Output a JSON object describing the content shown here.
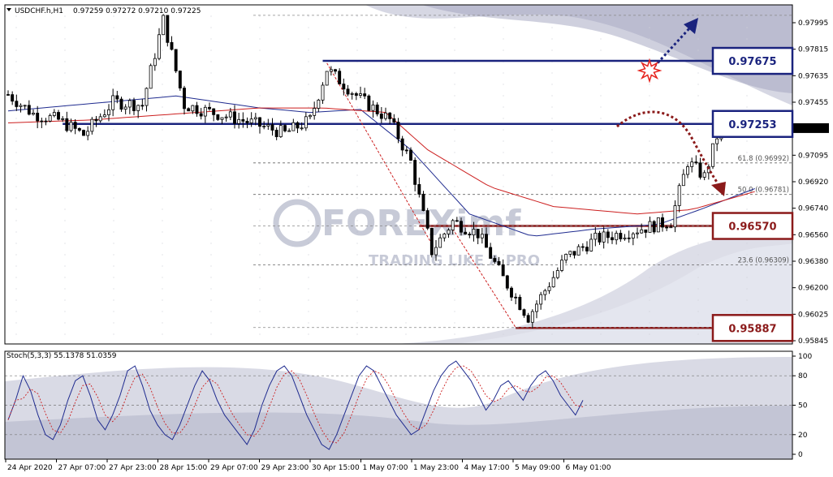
{
  "header": {
    "symbol": "USDCHF.h,H1",
    "ohlc": "0.97259 0.97272 0.97210 0.97225",
    "toggle_icon": "triangle-down-icon"
  },
  "watermark": {
    "brand": "FOREXimf",
    "tagline": "TRADING LIKE A PRO",
    "logo_icon": "foreximf-logo-icon"
  },
  "colors": {
    "blue_level": "#1a237e",
    "red_level": "#8b1a1a",
    "band": "#b4b6cc",
    "ma_fast": "#1f2b8f",
    "ma_slow": "#cc1f1f",
    "candle": "#000000"
  },
  "chart_data": [
    {
      "type": "candlestick",
      "title": "USDCHF.h,H1",
      "ylim": [
        0.9578,
        0.9805
      ],
      "y_ticks": [
        "0.97995",
        "0.97815",
        "0.97635",
        "0.97455",
        "0.97275",
        "0.97095",
        "0.96920",
        "0.96740",
        "0.96560",
        "0.96380",
        "0.96200",
        "0.96025",
        "0.95845"
      ],
      "current_price": "0.97225",
      "x_ticks": [
        "24 Apr 2020",
        "27 Apr 07:00",
        "27 Apr 23:00",
        "28 Apr 15:00",
        "29 Apr 07:00",
        "29 Apr 23:00",
        "30 Apr 15:00",
        "1 May 07:00",
        "1 May 23:00",
        "4 May 17:00",
        "5 May 09:00",
        "6 May 01:00"
      ],
      "price_anchors": [
        [
          0,
          0.9745
        ],
        [
          6,
          0.9732
        ],
        [
          12,
          0.9728
        ],
        [
          18,
          0.9718
        ],
        [
          25,
          0.974
        ],
        [
          32,
          0.9738
        ],
        [
          37,
          0.9795
        ],
        [
          42,
          0.9738
        ],
        [
          50,
          0.9732
        ],
        [
          58,
          0.9726
        ],
        [
          66,
          0.9719
        ],
        [
          72,
          0.9728
        ],
        [
          76,
          0.9762
        ],
        [
          84,
          0.9742
        ],
        [
          91,
          0.9728
        ],
        [
          96,
          0.97
        ],
        [
          101,
          0.964
        ],
        [
          106,
          0.966
        ],
        [
          112,
          0.9652
        ],
        [
          118,
          0.9622
        ],
        [
          124,
          0.9596
        ],
        [
          128,
          0.9614
        ],
        [
          133,
          0.9636
        ],
        [
          140,
          0.9648
        ],
        [
          146,
          0.9652
        ],
        [
          152,
          0.9656
        ],
        [
          158,
          0.966
        ],
        [
          162,
          0.97
        ],
        [
          166,
          0.969
        ],
        [
          170,
          0.9726
        ],
        [
          176,
          0.9722
        ],
        [
          180,
          0.9723
        ]
      ],
      "moving_averages": [
        {
          "name": "ma_fast",
          "points": [
            [
              0,
              0.9734
            ],
            [
              20,
              0.9739
            ],
            [
              40,
              0.9744
            ],
            [
              60,
              0.9736
            ],
            [
              72,
              0.9733
            ],
            [
              84,
              0.9735
            ],
            [
              96,
              0.9708
            ],
            [
              110,
              0.9665
            ],
            [
              125,
              0.965
            ],
            [
              140,
              0.9655
            ],
            [
              155,
              0.9658
            ],
            [
              165,
              0.9668
            ],
            [
              178,
              0.9682
            ]
          ]
        },
        {
          "name": "ma_slow",
          "points": [
            [
              0,
              0.9726
            ],
            [
              20,
              0.9728
            ],
            [
              40,
              0.9732
            ],
            [
              60,
              0.9736
            ],
            [
              75,
              0.9736
            ],
            [
              90,
              0.9733
            ],
            [
              100,
              0.9708
            ],
            [
              115,
              0.9683
            ],
            [
              130,
              0.967
            ],
            [
              150,
              0.9665
            ],
            [
              163,
              0.9668
            ],
            [
              178,
              0.968
            ]
          ]
        }
      ],
      "levels": [
        {
          "value": 0.97675,
          "label": "0.97675",
          "color": "blue",
          "from_bar": 75
        },
        {
          "value": 0.97253,
          "label": "0.97253",
          "color": "blue",
          "from_bar": 13
        },
        {
          "value": 0.9657,
          "label": "0.96570",
          "color": "red",
          "from_bar": 98
        },
        {
          "value": 0.95887,
          "label": "0.95887",
          "color": "red",
          "from_bar": 121
        }
      ],
      "fibonacci": [
        {
          "value": 0.96992,
          "label": "61.8 (0.96992)"
        },
        {
          "value": 0.96781,
          "label": "50.0 (0.96781)"
        },
        {
          "value": 0.96309,
          "label": "23.6 (0.96309)"
        }
      ],
      "annotations": [
        {
          "type": "arrow-up-right",
          "color": "blue"
        },
        {
          "type": "arrow-down-curved",
          "color": "red"
        },
        {
          "type": "breakout-star-icon"
        }
      ]
    },
    {
      "type": "line",
      "title": "Stoch(5,3,3) 55.1378 51.0359",
      "ylim": [
        0,
        100
      ],
      "y_ticks": [
        "100",
        "80",
        "50",
        "20",
        "0"
      ],
      "levels": [
        80,
        50,
        20
      ],
      "series": [
        {
          "name": "main",
          "values": [
            35,
            55,
            80,
            65,
            40,
            20,
            15,
            30,
            55,
            75,
            80,
            60,
            35,
            25,
            40,
            60,
            85,
            90,
            70,
            45,
            30,
            20,
            15,
            30,
            50,
            70,
            85,
            75,
            55,
            40,
            30,
            20,
            10,
            25,
            50,
            70,
            85,
            90,
            80,
            60,
            40,
            25,
            10,
            5,
            20,
            40,
            60,
            80,
            90,
            85,
            70,
            55,
            40,
            30,
            20,
            25,
            45,
            65,
            80,
            90,
            95,
            85,
            75,
            60,
            45,
            55,
            70,
            75,
            65,
            55,
            70,
            80,
            85,
            75,
            60,
            50,
            40,
            55
          ]
        }
      ]
    }
  ]
}
